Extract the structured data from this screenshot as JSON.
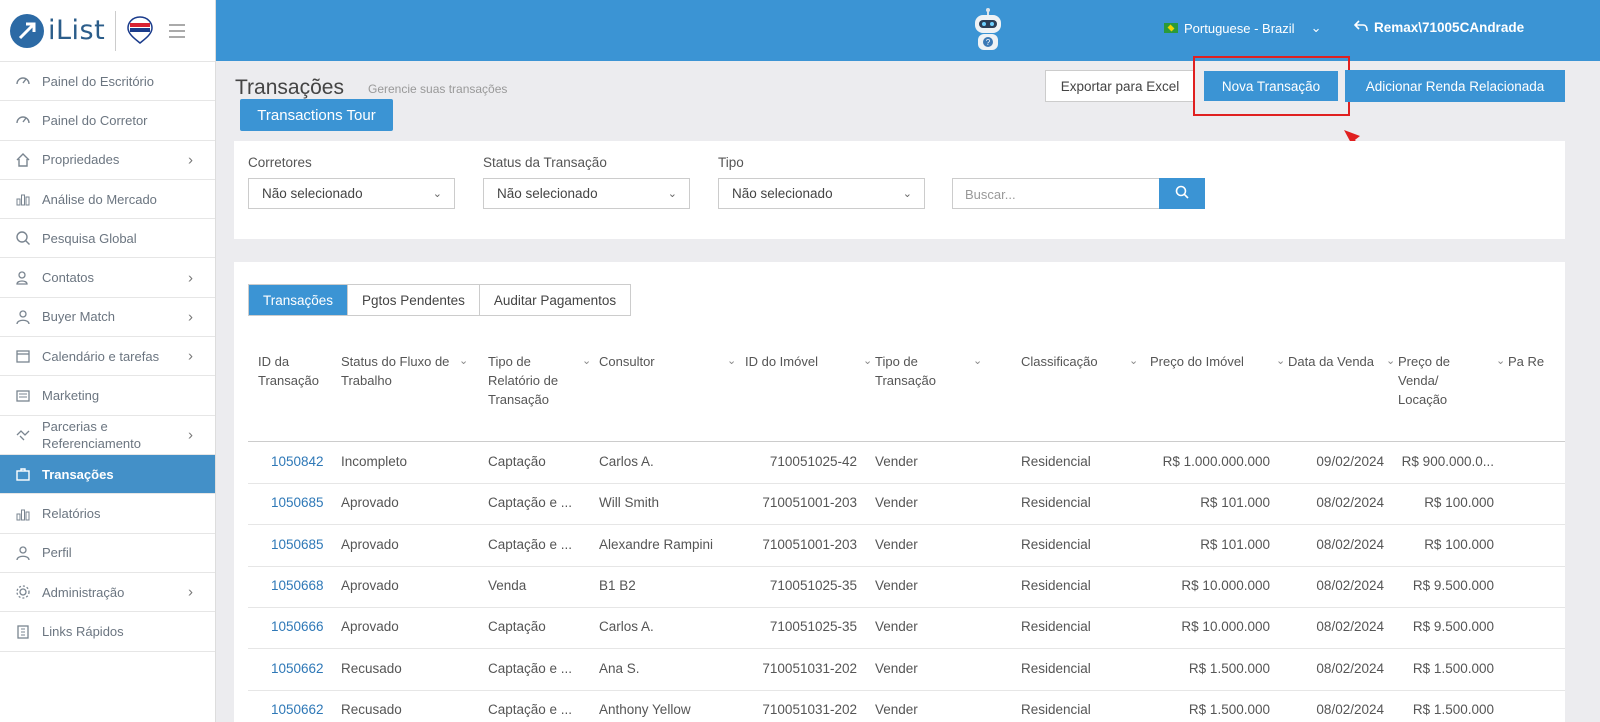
{
  "app": {
    "name": "iList"
  },
  "topbar": {
    "language": "Portuguese - Brazil",
    "user": "Remax\\71005CAndrade"
  },
  "sidebar": {
    "items": [
      {
        "label": "Painel do Escritório",
        "icon": "gauge-icon",
        "chevron": false
      },
      {
        "label": "Painel do Corretor",
        "icon": "gauge-icon",
        "chevron": false
      },
      {
        "label": "Propriedades",
        "icon": "home-icon",
        "chevron": true
      },
      {
        "label": "Análise do Mercado",
        "icon": "bar-chart-icon",
        "chevron": false
      },
      {
        "label": "Pesquisa Global",
        "icon": "search-icon",
        "chevron": false
      },
      {
        "label": "Contatos",
        "icon": "contacts-icon",
        "chevron": true
      },
      {
        "label": "Buyer Match",
        "icon": "user-icon",
        "chevron": true
      },
      {
        "label": "Calendário e tarefas",
        "icon": "calendar-icon",
        "chevron": true
      },
      {
        "label": "Marketing",
        "icon": "newspaper-icon",
        "chevron": false
      },
      {
        "label": "Parcerias e Referenciamento",
        "icon": "handshake-icon",
        "chevron": true
      },
      {
        "label": "Transações",
        "icon": "briefcase-icon",
        "chevron": false,
        "active": true
      },
      {
        "label": "Relatórios",
        "icon": "bar-chart-icon",
        "chevron": false
      },
      {
        "label": "Perfil",
        "icon": "user-icon",
        "chevron": false
      },
      {
        "label": "Administração",
        "icon": "gear-icon",
        "chevron": true
      },
      {
        "label": "Links Rápidos",
        "icon": "building-icon",
        "chevron": false
      }
    ]
  },
  "header": {
    "title": "Transações",
    "subtitle": "Gerencie suas transações",
    "tour_label": "Transactions Tour",
    "export_label": "Exportar para Excel",
    "new_label": "Nova Transação",
    "income_label": "Adicionar Renda Relacionada"
  },
  "filters": {
    "brokers_label": "Corretores",
    "brokers_value": "Não selecionado",
    "status_label": "Status da Transação",
    "status_value": "Não selecionado",
    "type_label": "Tipo",
    "type_value": "Não selecionado",
    "search_placeholder": "Buscar..."
  },
  "tabs": [
    "Transações",
    "Pgtos Pendentes",
    "Auditar Pagamentos"
  ],
  "table": {
    "columns": [
      "ID da Transação",
      "Status do Fluxo de Trabalho",
      "Tipo de Relatório de Transação",
      "Consultor",
      "ID do Imóvel",
      "Tipo de Transação",
      "Classificação",
      "Preço do Imóvel",
      "Data da Venda",
      "Preço de Venda/ Locação",
      "Pa Re"
    ],
    "rows": [
      [
        "1050842",
        "Incompleto",
        "Captação",
        "Carlos A.",
        "710051025-42",
        "Vender",
        "Residencial",
        "R$ 1.000.000.000",
        "09/02/2024",
        "R$ 900.000.0..."
      ],
      [
        "1050685",
        "Aprovado",
        "Captação e ...",
        "Will Smith",
        "710051001-203",
        "Vender",
        "Residencial",
        "R$ 101.000",
        "08/02/2024",
        "R$ 100.000"
      ],
      [
        "1050685",
        "Aprovado",
        "Captação e ...",
        "Alexandre Rampini",
        "710051001-203",
        "Vender",
        "Residencial",
        "R$ 101.000",
        "08/02/2024",
        "R$ 100.000"
      ],
      [
        "1050668",
        "Aprovado",
        "Venda",
        "B1 B2",
        "710051025-35",
        "Vender",
        "Residencial",
        "R$ 10.000.000",
        "08/02/2024",
        "R$ 9.500.000"
      ],
      [
        "1050666",
        "Aprovado",
        "Captação",
        "Carlos A.",
        "710051025-35",
        "Vender",
        "Residencial",
        "R$ 10.000.000",
        "08/02/2024",
        "R$ 9.500.000"
      ],
      [
        "1050662",
        "Recusado",
        "Captação e ...",
        "Ana S.",
        "710051031-202",
        "Vender",
        "Residencial",
        "R$ 1.500.000",
        "08/02/2024",
        "R$ 1.500.000"
      ],
      [
        "1050662",
        "Recusado",
        "Captação e ...",
        "Anthony Yellow",
        "710051031-202",
        "Vender",
        "Residencial",
        "R$ 1.500.000",
        "08/02/2024",
        "R$ 1.500.000"
      ]
    ]
  }
}
